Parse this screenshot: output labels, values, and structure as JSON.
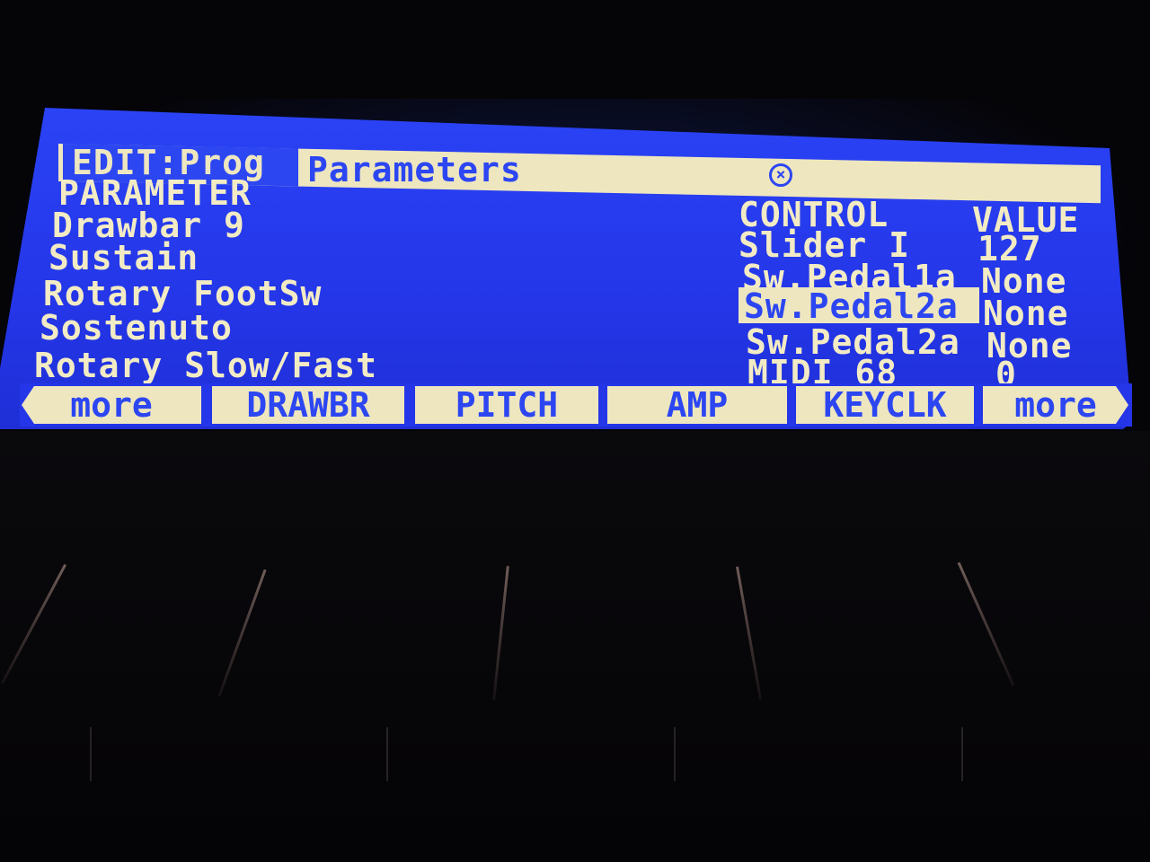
{
  "header": {
    "mode": "EDIT:Prog",
    "title": "Parameters",
    "icon": "circle-x-icon"
  },
  "columns": {
    "parameter": "PARAMETER",
    "control": "CONTROL",
    "value": "VALUE"
  },
  "parameters": [
    "Drawbar 9",
    "Sustain",
    "Rotary FootSw",
    "Sostenuto",
    "Rotary Slow/Fast"
  ],
  "controls": [
    {
      "control": "Slider I",
      "value": "127"
    },
    {
      "control": "Sw.Pedal1a",
      "value": "None"
    },
    {
      "control": "Sw.Pedal2a",
      "value": "None",
      "selected": true
    },
    {
      "control": "Sw.Pedal2a",
      "value": "None"
    },
    {
      "control": "MIDI 68",
      "value": "0"
    }
  ],
  "softkeys": [
    "more",
    "DRAWBR",
    "PITCH",
    "AMP",
    "KEYCLK",
    "more"
  ],
  "colors": {
    "lcd_background": "#2a43f5",
    "lcd_text": "#f2ebc4"
  }
}
